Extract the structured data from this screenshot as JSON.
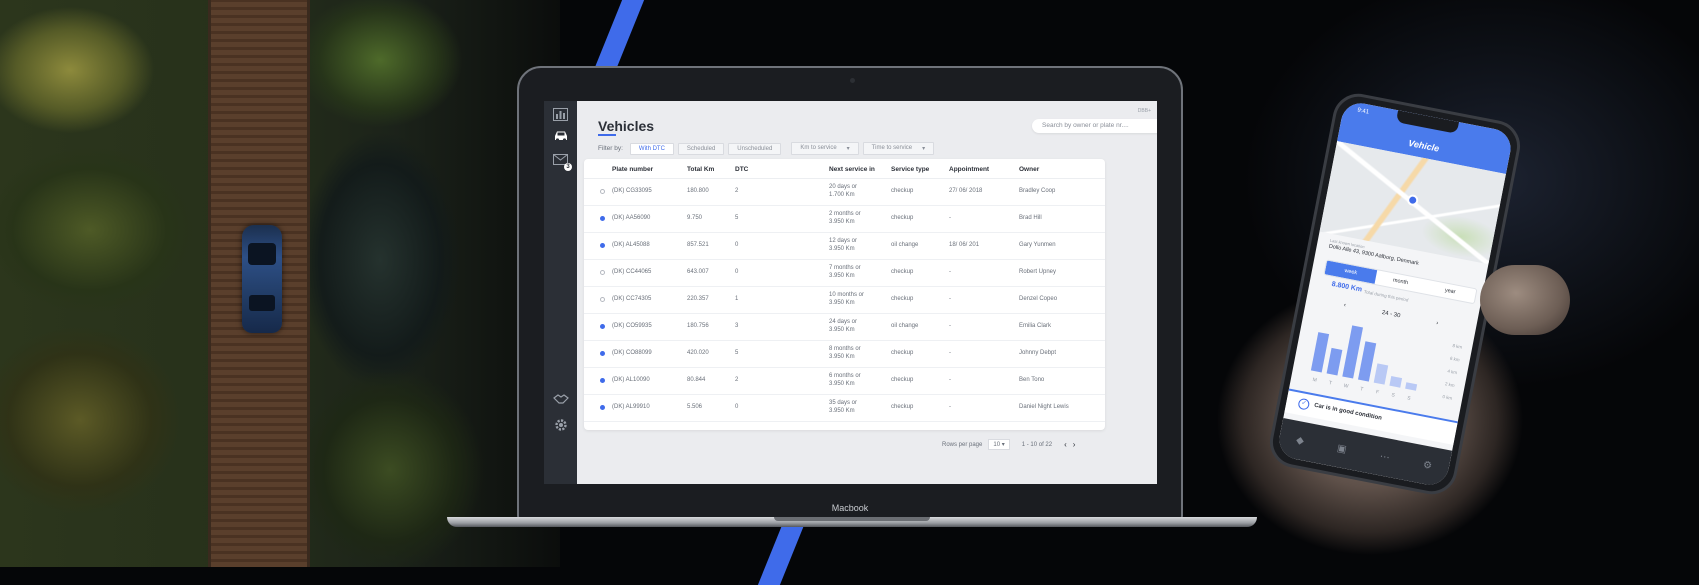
{
  "app": {
    "title": "Vehicles",
    "corner_text": "DBB+",
    "search_placeholder": "Search by owner or plate nr....",
    "sidebar_icons": [
      "bar-chart-icon",
      "car-icon",
      "mail-icon",
      "handshake-icon",
      "gear-icon"
    ],
    "mail_badge": "3",
    "filter_label": "Filter by:",
    "filters": [
      {
        "label": "With DTC",
        "active": true
      },
      {
        "label": "Scheduled",
        "active": false
      },
      {
        "label": "Unscheduled",
        "active": false
      }
    ],
    "dropdowns": [
      {
        "label": "Km to service",
        "arrow": "▾"
      },
      {
        "label": "Time to service",
        "arrow": "▾"
      }
    ],
    "table": {
      "columns": [
        "Plate number",
        "Total Km",
        "DTC",
        "Next service in",
        "Service type",
        "Appointment",
        "Owner"
      ],
      "rows": [
        {
          "status": "off",
          "plate": "(DK) CG33095",
          "km": "180.800",
          "dtc": "2",
          "next1": "20 days or",
          "next2": "1.700 Km",
          "type": "checkup",
          "appt": "27/ 06/ 2018",
          "owner": "Bradley Coop"
        },
        {
          "status": "on",
          "plate": "(DK) AA56090",
          "km": "9.750",
          "dtc": "5",
          "next1": "2 months or",
          "next2": "3.950 Km",
          "type": "checkup",
          "appt": "-",
          "owner": "Brad Hill"
        },
        {
          "status": "on",
          "plate": "(DK) AL45088",
          "km": "857.521",
          "dtc": "0",
          "next1": "12 days or",
          "next2": "3.950 Km",
          "type": "oil change",
          "appt": "18/ 06/ 201",
          "owner": "Gary Yunmen"
        },
        {
          "status": "off",
          "plate": "(DK) CC44065",
          "km": "643.007",
          "dtc": "0",
          "next1": "7 months or",
          "next2": "3.950 Km",
          "type": "checkup",
          "appt": "-",
          "owner": "Robert Upney"
        },
        {
          "status": "off",
          "plate": "(DK) CC74305",
          "km": "220.357",
          "dtc": "1",
          "next1": "10 months or",
          "next2": "3.950 Km",
          "type": "checkup",
          "appt": "-",
          "owner": "Denzel Copeo"
        },
        {
          "status": "on",
          "plate": "(DK) CO59935",
          "km": "180.756",
          "dtc": "3",
          "next1": "24 days or",
          "next2": "3.950 Km",
          "type": "oil change",
          "appt": "-",
          "owner": "Emilia Clark"
        },
        {
          "status": "on",
          "plate": "(DK) CO88099",
          "km": "420.020",
          "dtc": "5",
          "next1": "8 months or",
          "next2": "3.950 Km",
          "type": "checkup",
          "appt": "-",
          "owner": "Johnny Debpt"
        },
        {
          "status": "on",
          "plate": "(DK) AL10090",
          "km": "80.844",
          "dtc": "2",
          "next1": "6 months or",
          "next2": "3.950 Km",
          "type": "checkup",
          "appt": "-",
          "owner": "Ben Tono"
        },
        {
          "status": "on",
          "plate": "(DK) AL99910",
          "km": "5.506",
          "dtc": "0",
          "next1": "35 days or",
          "next2": "3.950 Km",
          "type": "checkup",
          "appt": "-",
          "owner": "Daniel Night Lewis"
        }
      ]
    },
    "pagination": {
      "rows_label": "Rows per page",
      "rows_value": "10",
      "rows_arrow": "▾",
      "range": "1 - 10 of 22",
      "prev": "‹",
      "next": "›"
    }
  },
  "laptop_label": "Macbook",
  "phone": {
    "time": "9:41",
    "title": "Vehicle",
    "last_known": "Last known location",
    "address": "Dollo Alle 43, 9300 Aalborg, Denmark",
    "tabs": [
      {
        "label": "week",
        "active": true
      },
      {
        "label": "month",
        "active": false
      },
      {
        "label": "year",
        "active": false
      }
    ],
    "distance": "8.800 Km",
    "distance_sub": "Total during this period",
    "range_label": "24 - 30",
    "range_prev": "‹",
    "range_next": "›",
    "chart_days": [
      "M",
      "T",
      "W",
      "T",
      "F",
      "S",
      "S"
    ],
    "chart_values": [
      6,
      4,
      8,
      6,
      3,
      1.5,
      1
    ],
    "chart_ticks": [
      "8 km",
      "6 km",
      "4 km",
      "2 km",
      "0 km"
    ],
    "status_text": "Car is in good condition",
    "nav_icons": [
      "car-icon",
      "vehicle-icon",
      "dots-icon",
      "gear-icon"
    ]
  },
  "colors": {
    "accent": "#3f6bea",
    "rail": "#2b2f36",
    "phone_header": "#4a7bec"
  }
}
